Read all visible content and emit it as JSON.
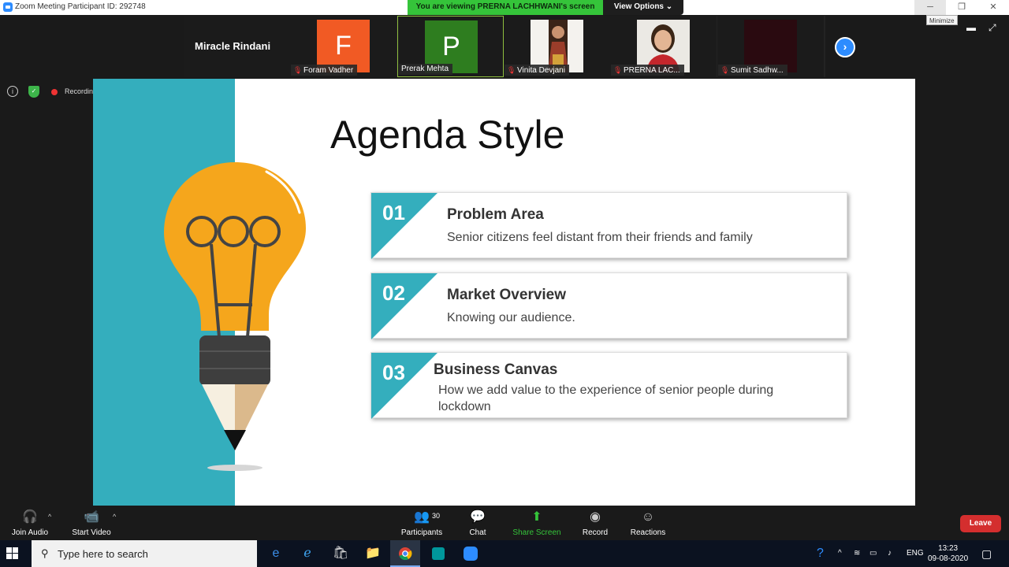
{
  "window": {
    "title": "Zoom Meeting Participant ID: 292748",
    "viewing_banner": "You are viewing PRERNA LACHHWANI's screen",
    "view_options": "View Options",
    "minimize": "─",
    "maximize": "❐",
    "close": "✕",
    "minimize_tooltip": "Minimize"
  },
  "gallery": {
    "speaker": "Miracle Rindani",
    "participants": [
      {
        "name": "Foram Vadher",
        "initial": "F",
        "color": "#f15a24",
        "muted": true
      },
      {
        "name": "Prerak Mehta",
        "initial": "P",
        "color": "#2e7d1f",
        "muted": false
      },
      {
        "name": "Vinita Devjani",
        "initial": "",
        "color": "",
        "muted": true
      },
      {
        "name": "PRERNA LAC...",
        "initial": "",
        "color": "",
        "muted": true
      },
      {
        "name": "Sumit Sadhw...",
        "initial": "",
        "color": "#2a0a10",
        "muted": true
      }
    ]
  },
  "status": {
    "recording": "Recording"
  },
  "slide": {
    "title": "Agenda Style",
    "items": [
      {
        "num": "01",
        "heading": "Problem Area",
        "desc": "Senior citizens feel distant from their friends and family"
      },
      {
        "num": "02",
        "heading": "Market Overview",
        "desc": "Knowing our audience."
      },
      {
        "num": "03",
        "heading": "Business Canvas",
        "desc": "How we add value to the experience of senior people during lockdown"
      }
    ]
  },
  "toolbar": {
    "join_audio": "Join Audio",
    "start_video": "Start Video",
    "participants": "Participants",
    "participant_count": "30",
    "chat": "Chat",
    "share_screen": "Share Screen",
    "record": "Record",
    "reactions": "Reactions",
    "leave": "Leave"
  },
  "taskbar": {
    "search_placeholder": "Type here to search",
    "language": "ENG",
    "time": "13:23",
    "date": "09-08-2020"
  },
  "colors": {
    "teal": "#34aebd",
    "bulb": "#f5a61c",
    "share_green": "#35c43a",
    "leave_red": "#d42e2e",
    "zoom_blue": "#2d8cff"
  }
}
